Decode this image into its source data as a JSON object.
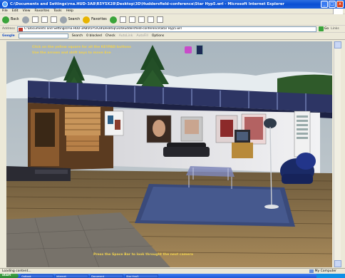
{
  "window": {
    "title": "C:\\Documents and Settings\\rna.HUD-3A8\\R5Y5X28\\Desktop\\3D\\Huddersfield-conference\\Star Hyp5.wrl - Microsoft Internet Explorer",
    "minimize": "_",
    "maximize": "□",
    "close": "x"
  },
  "menu": [
    "File",
    "Edit",
    "View",
    "Favorites",
    "Tools",
    "Help"
  ],
  "toolbar": {
    "back": "Back",
    "search": "Search",
    "favorites": "Favorites"
  },
  "address": {
    "label": "Address",
    "value": "C:\\Documents and Settings\\rna.HUD-3A8\\R5Y5X28\\Desktop\\3D\\Huddersfield-conference\\Star Hyp5.wrl",
    "go": "Go",
    "links": "Links"
  },
  "googlebar": {
    "logo": "Google",
    "search_btn": "Search",
    "blocked": "0 blocked",
    "check": "Check",
    "autolink": "AutoLink",
    "autofill": "AutoFill",
    "options": "Options"
  },
  "scene": {
    "instruction_1": "Click on the yellow square for all the KEYPAD buttons",
    "instruction_2": "Use the arrows and shift keys to move Eve",
    "bottom_hint": "Press the Space Bar to look throught the next camera"
  },
  "status": {
    "text": "Loading content...",
    "zone": "My Computer"
  },
  "taskbar": {
    "start": "start",
    "tasks": [
      "Outlook",
      "Internet",
      "Document",
      "Star Hyp5"
    ]
  },
  "colors": {
    "xp_blue": "#0a4fd4",
    "overlay_text": "#f1d24f",
    "floor_wood": "#8b6f45",
    "rug": "#3a4a7a"
  }
}
